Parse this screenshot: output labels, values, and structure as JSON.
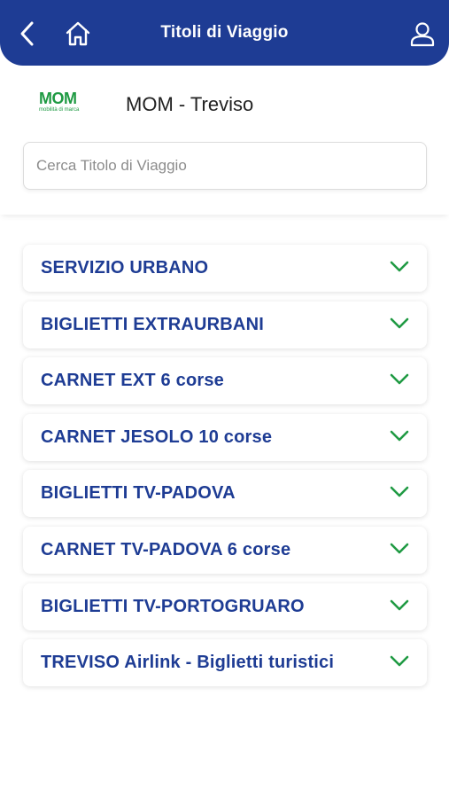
{
  "app": {
    "title": "Titoli di Viaggio"
  },
  "icons": {
    "back": "chevron-left-icon",
    "home": "home-icon",
    "user": "user-icon",
    "expand": "chevron-down-icon"
  },
  "colors": {
    "primary": "#1e3c94",
    "accent": "#1f9a43"
  },
  "operator": {
    "logo_text": "MOM",
    "logo_subtext": "mobilità di marca",
    "name": "MOM - Treviso"
  },
  "search": {
    "placeholder": "Cerca Titolo di Viaggio",
    "value": ""
  },
  "categories": [
    {
      "label": "SERVIZIO URBANO"
    },
    {
      "label": "BIGLIETTI EXTRAURBANI"
    },
    {
      "label": "CARNET EXT 6 corse"
    },
    {
      "label": "CARNET JESOLO 10 corse"
    },
    {
      "label": "BIGLIETTI TV-PADOVA"
    },
    {
      "label": "CARNET TV-PADOVA 6 corse"
    },
    {
      "label": "BIGLIETTI TV-PORTOGRUARO"
    },
    {
      "label": "TREVISO Airlink - Biglietti turistici"
    }
  ]
}
